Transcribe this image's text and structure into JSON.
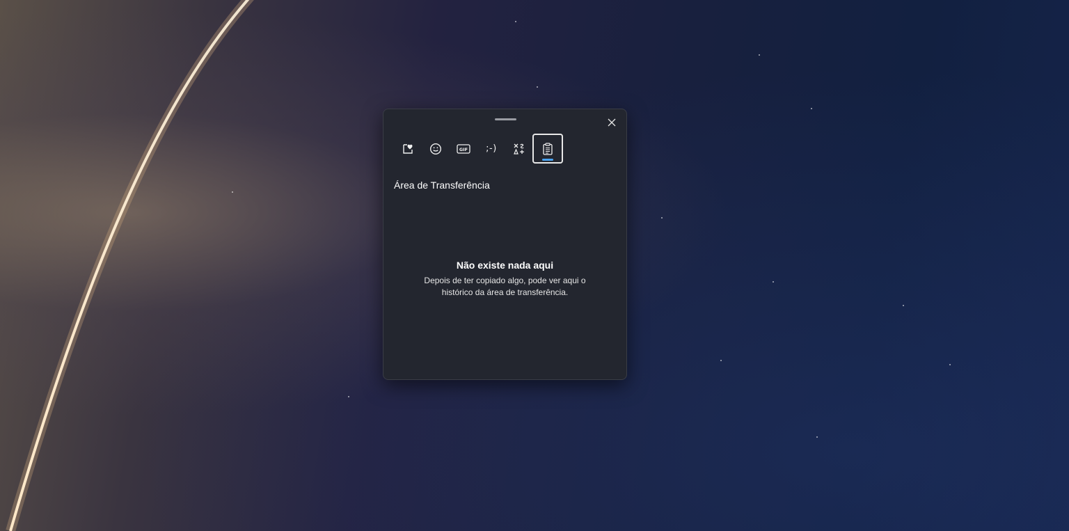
{
  "panel": {
    "close_icon": "close-icon",
    "tabs": [
      {
        "icon": "favorites-heart-icon",
        "active": false
      },
      {
        "icon": "emoji-smiley-icon",
        "active": false
      },
      {
        "icon": "gif-icon",
        "label": "GIF",
        "active": false
      },
      {
        "icon": "kaomoji-icon",
        "label": ";-)",
        "active": false
      },
      {
        "icon": "symbols-icon",
        "active": false
      },
      {
        "icon": "clipboard-icon",
        "active": true
      }
    ],
    "section_title": "Área de Transferência",
    "empty_state": {
      "title": "Não existe nada aqui",
      "description": "Depois de ter copiado algo, pode ver aqui o histórico da área de transferência."
    }
  },
  "colors": {
    "panel_bg": "#23262f",
    "accent": "#4aa3f0"
  }
}
